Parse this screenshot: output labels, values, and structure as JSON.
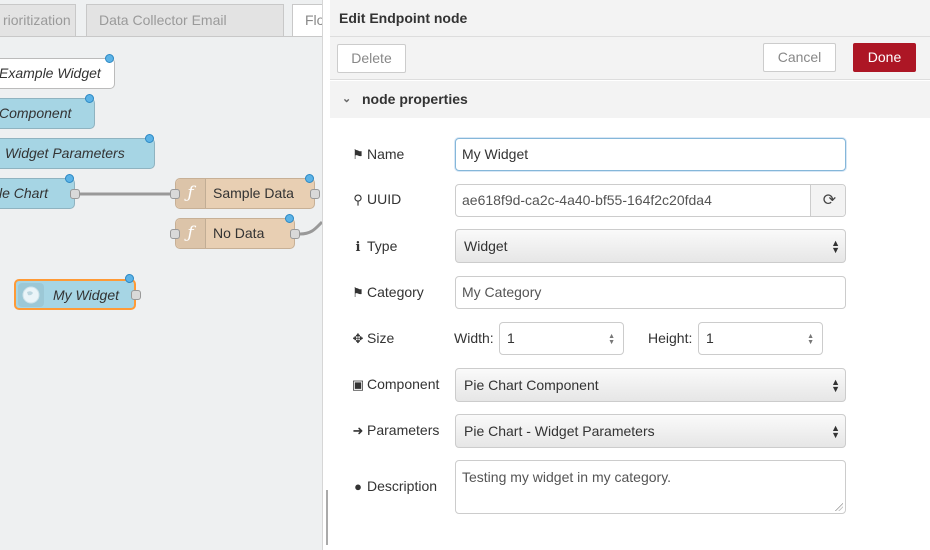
{
  "tabs": [
    {
      "label": "rioritization"
    },
    {
      "label": "Data Collector Email"
    },
    {
      "label": "Flo"
    }
  ],
  "flow_nodes": {
    "example_widget": "Example Widget",
    "component": "Component",
    "widget_parameters": "Widget Parameters",
    "le_chart": "le Chart",
    "sample_data": "Sample Data",
    "no_data": "No Data",
    "my_widget": "My Widget"
  },
  "tray": {
    "title": "Edit Endpoint node",
    "delete_label": "Delete",
    "cancel_label": "Cancel",
    "done_label": "Done",
    "section_title": "node properties",
    "section_icon": "chevron-down-icon"
  },
  "form": {
    "name": {
      "label": "Name",
      "icon": "tag-icon",
      "value": "My Widget"
    },
    "uuid": {
      "label": "UUID",
      "icon": "key-icon",
      "value": "ae618f9d-ca2c-4a40-bf55-164f2c20fda4"
    },
    "type": {
      "label": "Type",
      "icon": "info-icon",
      "value": "Widget"
    },
    "category": {
      "label": "Category",
      "icon": "tags-icon",
      "value": "My Category"
    },
    "size": {
      "label": "Size",
      "icon": "arrows-icon",
      "width_label": "Width:",
      "width_value": "1",
      "height_label": "Height:",
      "height_value": "1"
    },
    "component": {
      "label": "Component",
      "icon": "cubes-icon",
      "value": "Pie Chart Component"
    },
    "parameters": {
      "label": "Parameters",
      "icon": "sign-in-icon",
      "value": "Pie Chart - Widget Parameters"
    },
    "description": {
      "label": "Description",
      "icon": "comment-icon",
      "value": "Testing my widget in my category."
    }
  },
  "colors": {
    "done_button": "#ad1625",
    "node_blue": "#a6d5e4",
    "node_tan": "#e8cfb3",
    "selected_outline": "#ff9a36"
  }
}
